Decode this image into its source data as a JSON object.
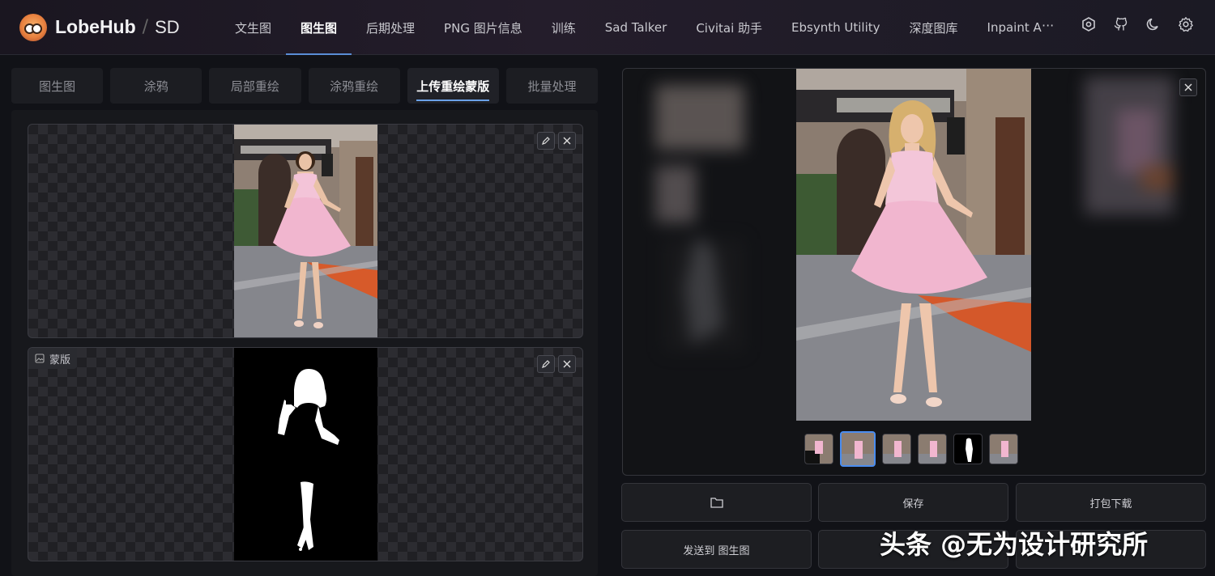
{
  "brand": {
    "name": "LobeHub",
    "separator": "/",
    "sub": "SD"
  },
  "nav": {
    "items": [
      "文生图",
      "图生图",
      "后期处理",
      "PNG 图片信息",
      "训练",
      "Sad Talker",
      "Civitai 助手",
      "Ebsynth Utility",
      "深度图库",
      "Inpaint A"
    ],
    "active_index": 1,
    "more": "···"
  },
  "header_icons": [
    "hexagon-icon",
    "github-icon",
    "moon-icon",
    "gear-icon"
  ],
  "subtabs": {
    "items": [
      "图生图",
      "涂鸦",
      "局部重绘",
      "涂鸦重绘",
      "上传重绘蒙版",
      "批量处理"
    ],
    "active_index": 4
  },
  "mask_panel": {
    "label": "蒙版"
  },
  "actions": {
    "folder_icon": "folder-icon",
    "save": "保存",
    "zip_download": "打包下载",
    "send_img2img": "发送到 图生图"
  },
  "thumbnails": {
    "count": 6,
    "active_index": 1
  },
  "watermark": "头条 @无为设计研究所",
  "colors": {
    "accent": "#5a8dd6",
    "thumb_active": "#4a8df0",
    "dress": "#f1b6cf"
  }
}
